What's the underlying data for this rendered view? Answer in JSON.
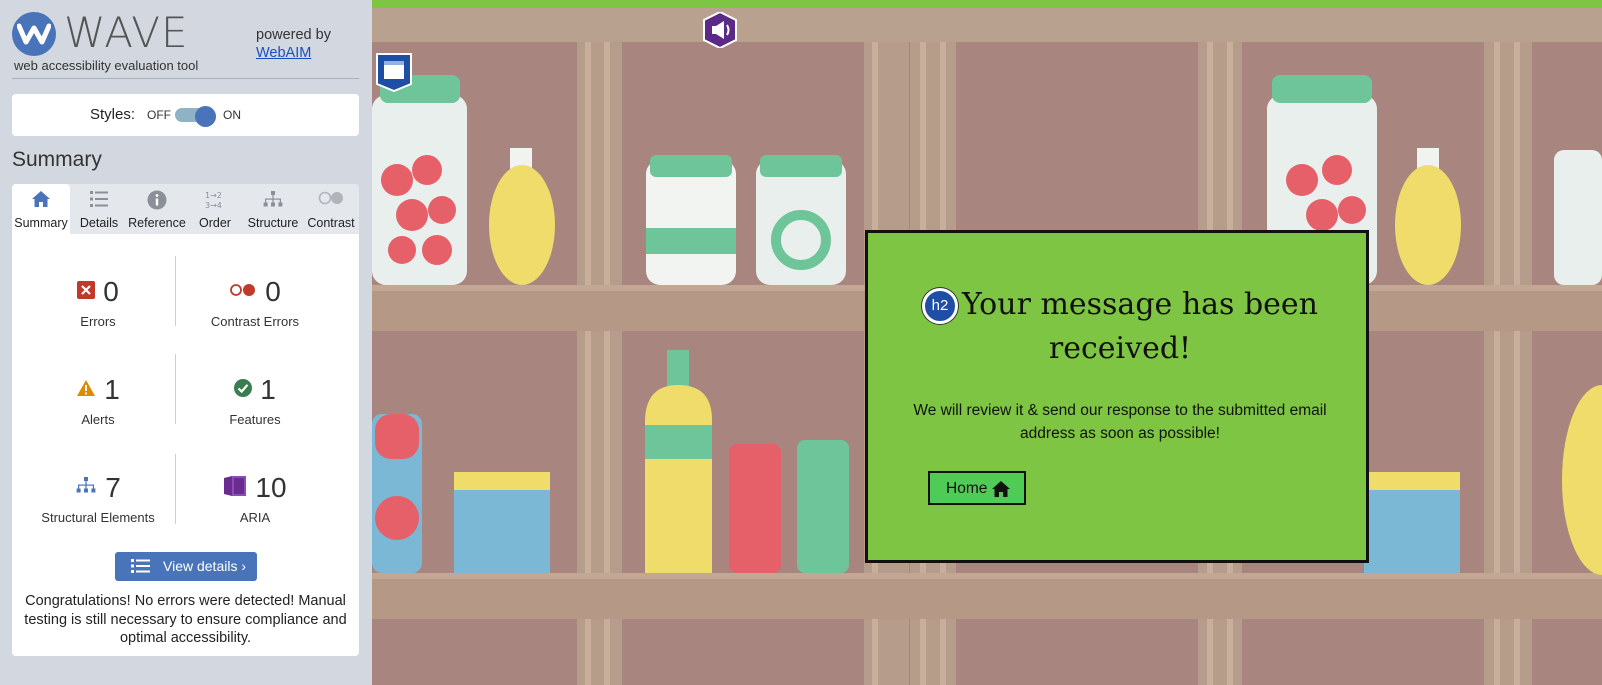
{
  "sidebar": {
    "logo_text": "WAVE",
    "logo_subtitle": "web accessibility evaluation tool",
    "powered_by": "powered by",
    "webaim_link": "WebAIM",
    "styles": {
      "label": "Styles:",
      "off": "OFF",
      "on": "ON",
      "state": "on"
    },
    "summary_heading": "Summary",
    "tabs": [
      {
        "label": "Summary",
        "icon": "home-icon",
        "active": true
      },
      {
        "label": "Details",
        "icon": "list-icon"
      },
      {
        "label": "Reference",
        "icon": "info-icon"
      },
      {
        "label": "Order",
        "icon": "order-icon"
      },
      {
        "label": "Structure",
        "icon": "structure-icon"
      },
      {
        "label": "Contrast",
        "icon": "contrast-icon"
      }
    ],
    "stats": {
      "errors": {
        "count": "0",
        "label": "Errors",
        "color": "#c0392b"
      },
      "contrast_errors": {
        "count": "0",
        "label": "Contrast Errors",
        "color": "#c0392b"
      },
      "alerts": {
        "count": "1",
        "label": "Alerts",
        "color": "#e08a00"
      },
      "features": {
        "count": "1",
        "label": "Features",
        "color": "#3a7d4f"
      },
      "structural": {
        "count": "7",
        "label": "Structural Elements",
        "color": "#4a74b9"
      },
      "aria": {
        "count": "10",
        "label": "ARIA",
        "color": "#6a2c91"
      }
    },
    "view_details": "View details ›",
    "congrats": "Congratulations! No errors were detected! Manual testing is still necessary to ensure compliance and optimal accessibility."
  },
  "page": {
    "modal": {
      "heading_badge": "h2",
      "heading": "Your message has been received!",
      "message": "We will review it & send our response to the submitted email address as soon as possible!",
      "home_button": "Home"
    }
  },
  "colors": {
    "accent": "#4a74b9",
    "modal_bg": "#7dc542",
    "home_button": "#4fcc55"
  }
}
